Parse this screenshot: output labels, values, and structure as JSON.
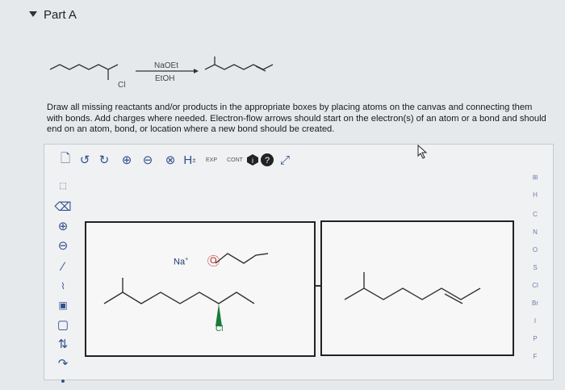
{
  "part": {
    "title": "Part A"
  },
  "reaction": {
    "reagent_top": "NaOEt",
    "reagent_bottom": "EtOH",
    "substituent": "Cl"
  },
  "instructions": "Draw all missing reactants and/or products in the appropriate boxes by placing atoms on the canvas and connecting them with bonds. Add charges where needed. Electron-flow arrows should start on the electron(s) of an atom or a bond and should end on an atom, bond, or location where a new bond should be created.",
  "toolbar": {
    "items": [
      {
        "icon": "new-document-icon"
      },
      {
        "icon": "undo-icon"
      },
      {
        "icon": "redo-icon"
      },
      {
        "icon": "zoom-in-icon"
      },
      {
        "icon": "zoom-out-icon"
      },
      {
        "icon": "clear-icon"
      },
      {
        "icon": "hydrogen-toggle-icon",
        "label": "H"
      },
      {
        "icon": "explicit-hydrogens-icon",
        "label": "EXP"
      },
      {
        "icon": "contract-icon",
        "label": "CONT"
      },
      {
        "icon": "info-icon"
      },
      {
        "icon": "help-icon"
      },
      {
        "icon": "fullscreen-icon"
      }
    ]
  },
  "periodic_table": {
    "elements": [
      "H",
      "C",
      "N",
      "O",
      "S",
      "Cl",
      "Br",
      "I",
      "P",
      "F"
    ]
  },
  "canvas": {
    "reactant_labels": {
      "sodium": "Na",
      "sodium_charge": "+",
      "oxygen": "O",
      "chlorine": "Cl"
    }
  },
  "colors": {
    "accent": "#2f4f8f",
    "background": "#e6e9ec",
    "box_border": "#222222",
    "bond_highlight": "#1a7a3a"
  }
}
